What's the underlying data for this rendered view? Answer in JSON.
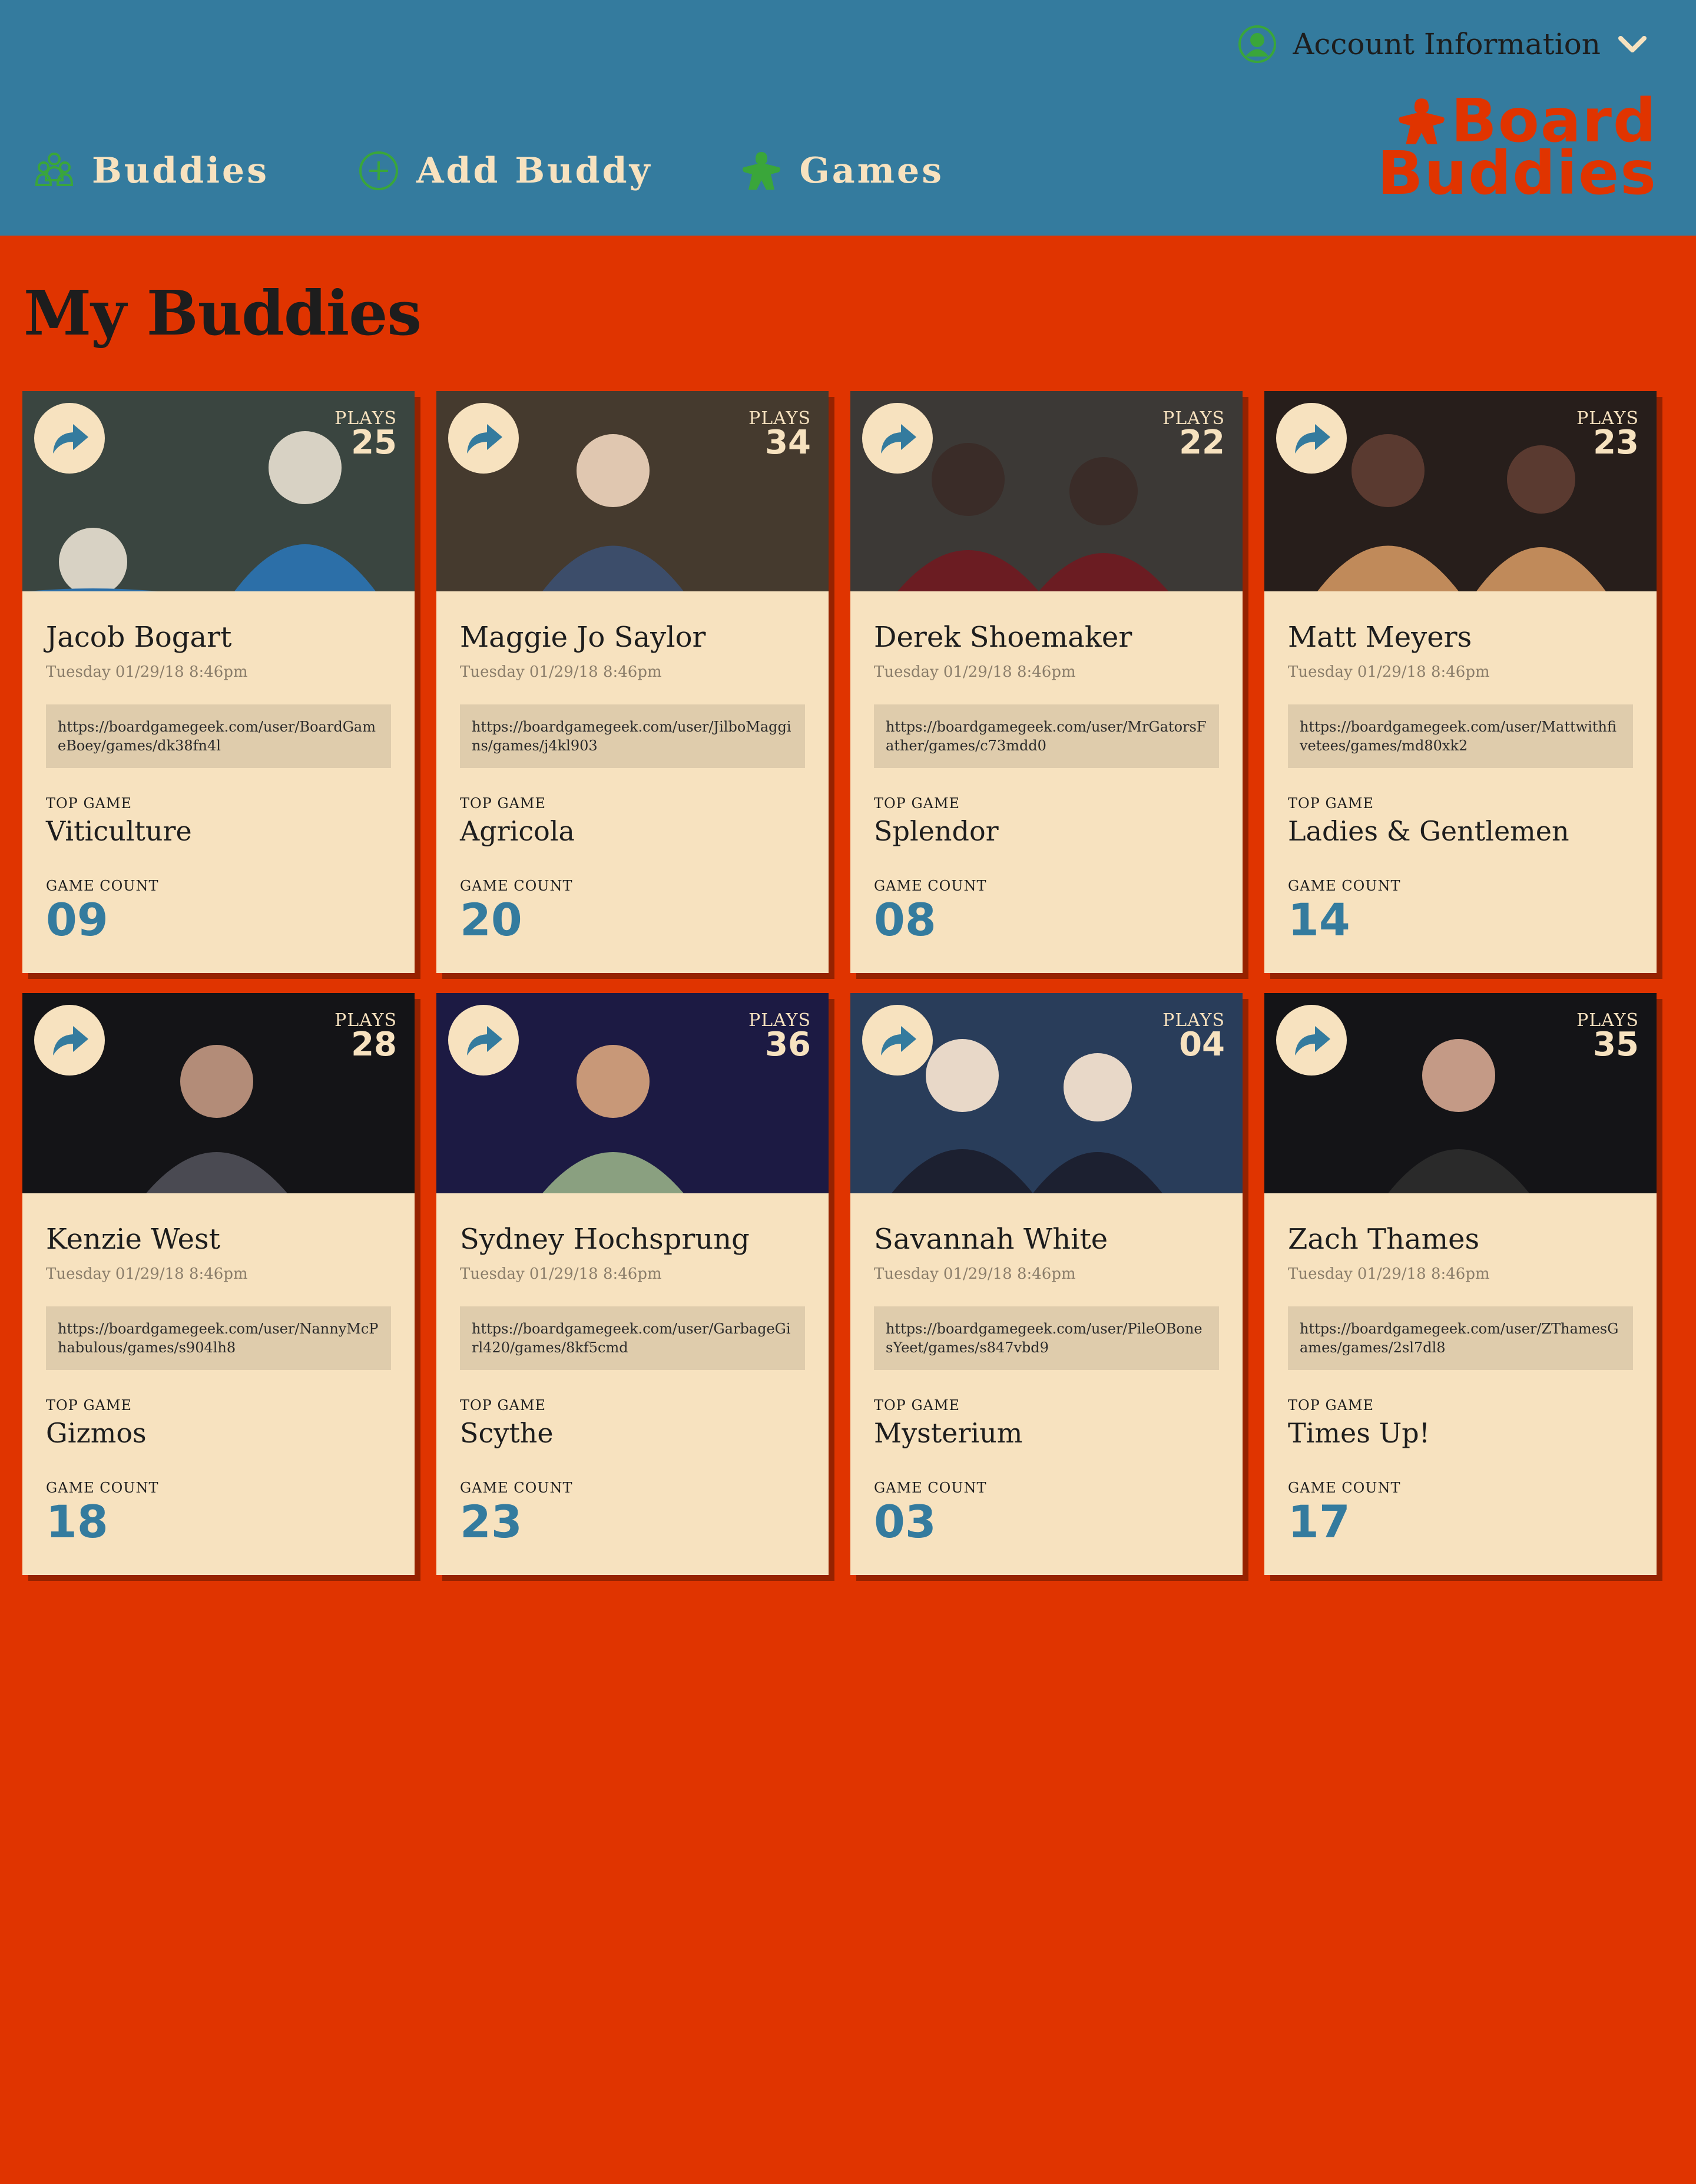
{
  "header": {
    "account_label": "Account Information",
    "nav": [
      {
        "label": "Buddies",
        "icon": "buddies-icon"
      },
      {
        "label": "Add Buddy",
        "icon": "add-circle-icon"
      },
      {
        "label": "Games",
        "icon": "meeple-icon"
      }
    ],
    "logo_line1": "Board",
    "logo_line2": "Buddies"
  },
  "page_title": "My Buddies",
  "labels": {
    "plays": "PLAYS",
    "top_game": "TOP GAME",
    "game_count": "GAME COUNT"
  },
  "buddies": [
    {
      "name": "Jacob Bogart",
      "date": "Tuesday 01/29/18 8:46pm",
      "url": "https://boardgamegeek.com/user/BoardGameBoey/games/dk38fn4l",
      "top_game": "Viticulture",
      "game_count": "09",
      "plays": "25"
    },
    {
      "name": "Maggie Jo Saylor",
      "date": "Tuesday 01/29/18 8:46pm",
      "url": "https://boardgamegeek.com/user/JilboMaggins/games/j4kl903",
      "top_game": "Agricola",
      "game_count": "20",
      "plays": "34"
    },
    {
      "name": "Derek Shoemaker",
      "date": "Tuesday 01/29/18 8:46pm",
      "url": "https://boardgamegeek.com/user/MrGatorsFather/games/c73mdd0",
      "top_game": "Splendor",
      "game_count": "08",
      "plays": "22"
    },
    {
      "name": "Matt Meyers",
      "date": "Tuesday 01/29/18 8:46pm",
      "url": "https://boardgamegeek.com/user/Mattwithfivetees/games/md80xk2",
      "top_game": "Ladies & Gentlemen",
      "game_count": "14",
      "plays": "23"
    },
    {
      "name": "Kenzie West",
      "date": "Tuesday 01/29/18 8:46pm",
      "url": "https://boardgamegeek.com/user/NannyMcPhabulous/games/s904lh8",
      "top_game": "Gizmos",
      "game_count": "18",
      "plays": "28"
    },
    {
      "name": "Sydney Hochsprung",
      "date": "Tuesday 01/29/18 8:46pm",
      "url": "https://boardgamegeek.com/user/GarbageGirl420/games/8kf5cmd",
      "top_game": "Scythe",
      "game_count": "23",
      "plays": "36"
    },
    {
      "name": "Savannah White",
      "date": "Tuesday 01/29/18 8:46pm",
      "url": "https://boardgamegeek.com/user/PileOBonesYeet/games/s847vbd9",
      "top_game": "Mysterium",
      "game_count": "03",
      "plays": "04"
    },
    {
      "name": "Zach Thames",
      "date": "Tuesday 01/29/18 8:46pm",
      "url": "https://boardgamegeek.com/user/ZThamesGames/games/2sl7dl8",
      "top_game": "Times Up!",
      "game_count": "17",
      "plays": "35"
    }
  ],
  "colors": {
    "header_bg": "#347b9e",
    "page_bg": "#e03400",
    "card_bg": "#f7e2bf",
    "accent_green": "#3aa63a",
    "count_blue": "#347b9e"
  }
}
